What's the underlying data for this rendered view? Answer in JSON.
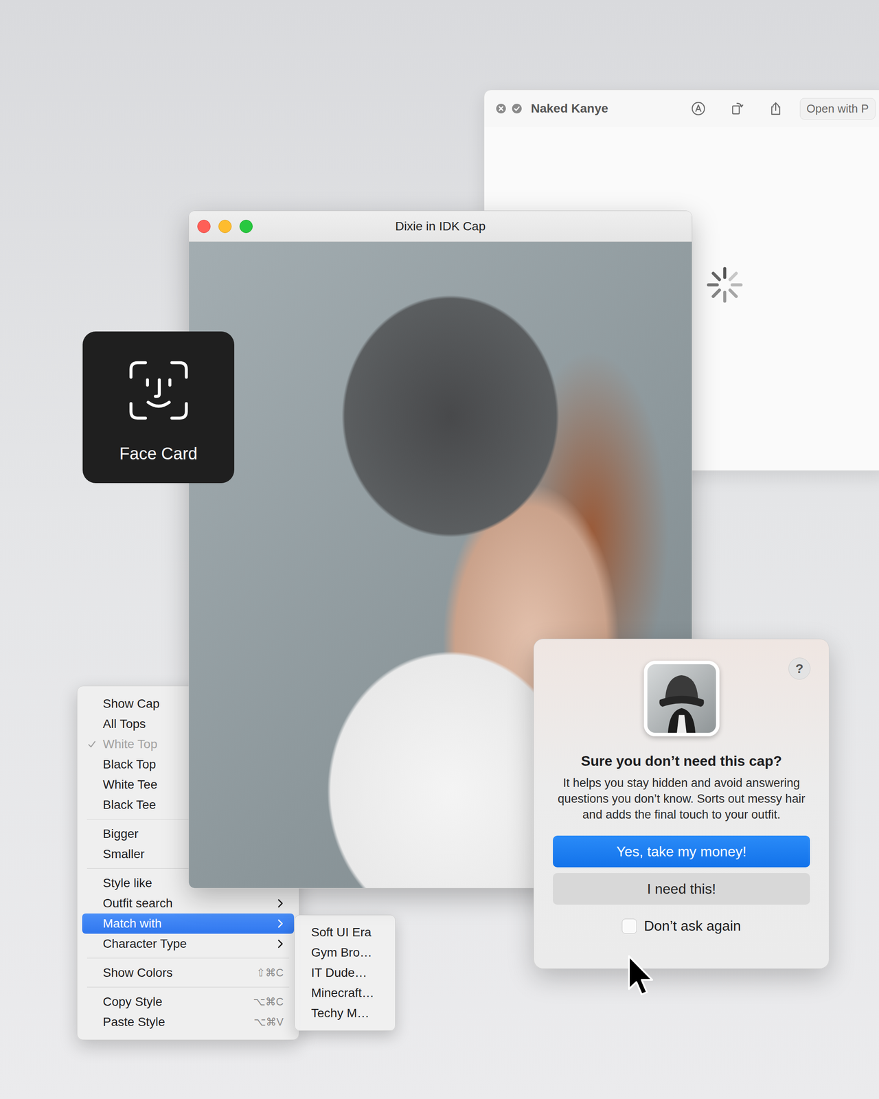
{
  "back_window": {
    "title": "Naked Kanye",
    "open_with": "Open with P",
    "loading": true
  },
  "photo_window": {
    "title": "Dixie in IDK Cap"
  },
  "hud": {
    "label": "Face Card"
  },
  "context_menu": {
    "groups": [
      [
        {
          "label": "Show Cap",
          "checked": false,
          "disabled": false,
          "selected": false,
          "submenu": false
        },
        {
          "label": "All Tops",
          "checked": false,
          "disabled": false,
          "selected": false,
          "submenu": false
        },
        {
          "label": "White Top",
          "checked": true,
          "disabled": true,
          "selected": false,
          "submenu": false
        },
        {
          "label": "Black Top",
          "checked": false,
          "disabled": false,
          "selected": false,
          "submenu": false
        },
        {
          "label": "White Tee",
          "checked": false,
          "disabled": false,
          "selected": false,
          "submenu": false
        },
        {
          "label": "Black Tee",
          "checked": false,
          "disabled": false,
          "selected": false,
          "submenu": false
        }
      ],
      [
        {
          "label": "Bigger",
          "checked": false,
          "disabled": false,
          "selected": false,
          "submenu": false
        },
        {
          "label": "Smaller",
          "checked": false,
          "disabled": false,
          "selected": false,
          "submenu": false
        }
      ],
      [
        {
          "label": "Style like",
          "checked": false,
          "disabled": false,
          "selected": false,
          "submenu": true
        },
        {
          "label": "Outfit search",
          "checked": false,
          "disabled": false,
          "selected": false,
          "submenu": true
        },
        {
          "label": "Match with",
          "checked": false,
          "disabled": false,
          "selected": true,
          "submenu": true
        },
        {
          "label": "Character Type",
          "checked": false,
          "disabled": false,
          "selected": false,
          "submenu": true
        }
      ],
      [
        {
          "label": "Show Colors",
          "checked": false,
          "disabled": false,
          "selected": false,
          "submenu": false,
          "shortcut": "⇧⌘C"
        }
      ],
      [
        {
          "label": "Copy Style",
          "checked": false,
          "disabled": false,
          "selected": false,
          "submenu": false,
          "shortcut": "⌥⌘C"
        },
        {
          "label": "Paste Style",
          "checked": false,
          "disabled": false,
          "selected": false,
          "submenu": false,
          "shortcut": "⌥⌘V"
        }
      ]
    ]
  },
  "submenu": {
    "items": [
      "Soft UI Era",
      "Gym Bro…",
      "IT Dude…",
      "Minecraft…",
      "Techy M…"
    ]
  },
  "dialog": {
    "title": "Sure you don’t need this cap?",
    "message": "It helps you stay hidden and avoid answering questions you don’t know. Sorts out messy hair and adds the final touch to your outfit.",
    "help": "?",
    "buttons": [
      {
        "label": "Yes, take my money!",
        "default": true
      },
      {
        "label": "I need this!",
        "default": false
      }
    ],
    "checkbox": {
      "label": "Don’t ask again",
      "checked": false
    }
  }
}
